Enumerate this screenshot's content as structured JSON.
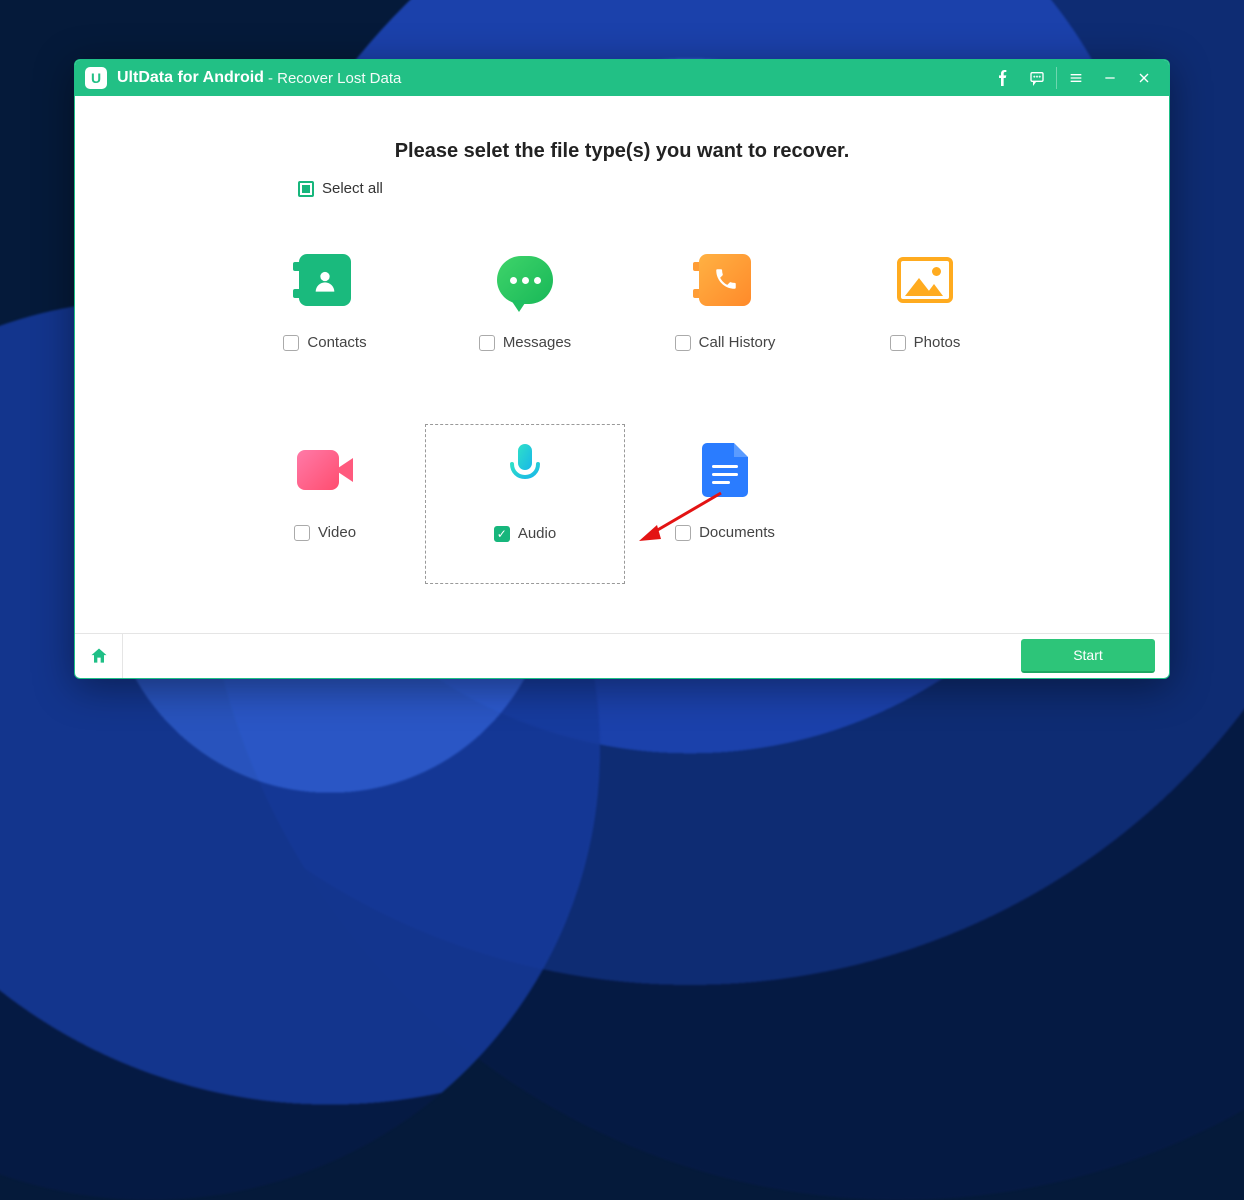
{
  "titlebar": {
    "app_name": "UltData for Android",
    "subtitle": "- Recover Lost Data"
  },
  "heading": "Please selet the file type(s) you want to recover.",
  "select_all_label": "Select all",
  "tiles": {
    "contacts": {
      "label": "Contacts",
      "checked": false
    },
    "messages": {
      "label": "Messages",
      "checked": false
    },
    "callhistory": {
      "label": "Call History",
      "checked": false
    },
    "photos": {
      "label": "Photos",
      "checked": false
    },
    "video": {
      "label": "Video",
      "checked": false
    },
    "audio": {
      "label": "Audio",
      "checked": true
    },
    "documents": {
      "label": "Documents",
      "checked": false
    }
  },
  "footer": {
    "start_label": "Start"
  },
  "colors": {
    "accent": "#22c085",
    "accent_dark": "#17b67c"
  }
}
